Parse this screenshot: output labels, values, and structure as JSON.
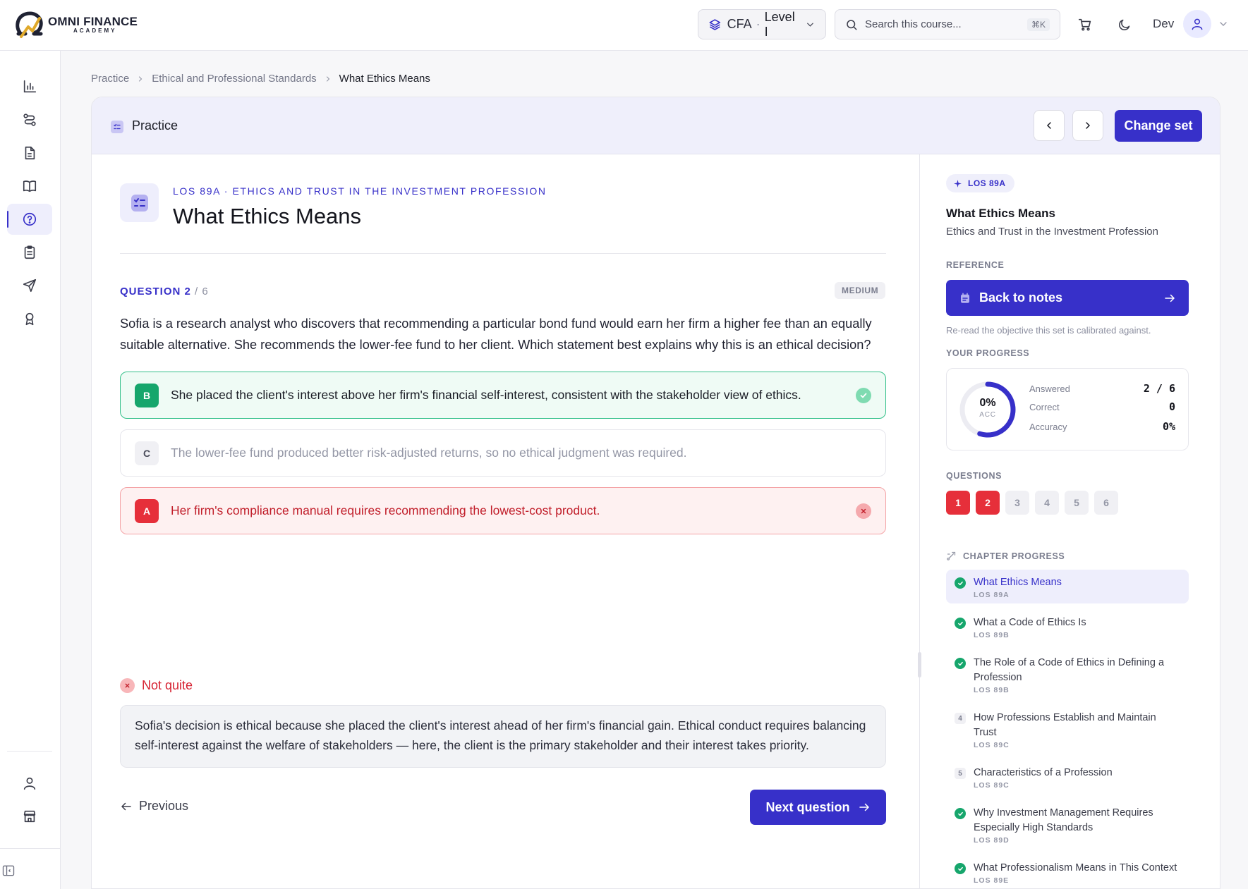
{
  "app": {
    "logo_title": "OMNI FINANCE",
    "logo_sub": "ACADEMY"
  },
  "header": {
    "course_prefix": "CFA",
    "course_sep": "·",
    "course_level": "Level I",
    "search_placeholder": "Search this course...",
    "search_shortcut": "⌘K",
    "user_name": "Dev"
  },
  "breadcrumb": [
    "Practice",
    "Ethical and Professional Standards",
    "What Ethics Means"
  ],
  "practice": {
    "header_title": "Practice",
    "change_set_label": "Change set",
    "los_line": "LOS 89A · ETHICS AND TRUST IN THE INVESTMENT PROFESSION",
    "title": "What Ethics Means",
    "question_label": "QUESTION 2",
    "question_total": "/ 6",
    "difficulty": "MEDIUM",
    "question_text": "Sofia is a research analyst who discovers that recommending a particular bond fund would earn her firm a higher fee than an equally suitable alternative. She recommends the lower-fee fund to her client. Which statement best explains why this is an ethical decision?",
    "options": [
      {
        "letter": "B",
        "text": "She placed the client's interest above her firm's financial self-interest, consistent with the stakeholder view of ethics.",
        "state": "correct"
      },
      {
        "letter": "C",
        "text": "The lower-fee fund produced better risk-adjusted returns, so no ethical judgment was required.",
        "state": "neutral"
      },
      {
        "letter": "A",
        "text": "Her firm's compliance manual requires recommending the lowest-cost product.",
        "state": "wrong"
      }
    ],
    "feedback_title": "Not quite",
    "explanation": "Sofia's decision is ethical because she placed the client's interest ahead of her firm's financial gain. Ethical conduct requires balancing self-interest against the welfare of stakeholders — here, the client is the primary stakeholder and their interest takes priority.",
    "previous_label": "Previous",
    "next_label": "Next question"
  },
  "side": {
    "los_pill": "LOS 89A",
    "title": "What Ethics Means",
    "subtitle": "Ethics and Trust in the Investment Profession",
    "reference_label": "REFERENCE",
    "back_notes_label": "Back to notes",
    "reference_note": "Re-read the objective this set is calibrated against.",
    "progress_label": "YOUR PROGRESS",
    "ring_value": "0%",
    "ring_label": "ACC",
    "accuracy_fraction": 0.55,
    "stats": [
      {
        "label": "Answered",
        "value": "2 / 6"
      },
      {
        "label": "Correct",
        "value": "0"
      },
      {
        "label": "Accuracy",
        "value": "0%"
      }
    ],
    "questions_label": "QUESTIONS",
    "question_chips": [
      {
        "num": "1",
        "state": "wrong"
      },
      {
        "num": "2",
        "state": "wrong"
      },
      {
        "num": "3",
        "state": "todo"
      },
      {
        "num": "4",
        "state": "todo"
      },
      {
        "num": "5",
        "state": "todo"
      },
      {
        "num": "6",
        "state": "todo"
      }
    ],
    "chapter_label": "CHAPTER PROGRESS",
    "chapters": [
      {
        "title": "What Ethics Means",
        "los": "LOS 89A",
        "status": "done",
        "active": true
      },
      {
        "title": "What a Code of Ethics Is",
        "los": "LOS 89B",
        "status": "done"
      },
      {
        "title": "The Role of a Code of Ethics in Defining a Profession",
        "los": "LOS 89B",
        "status": "done"
      },
      {
        "title": "How Professions Establish and Maintain Trust",
        "los": "LOS 89C",
        "status": "num",
        "num": "4"
      },
      {
        "title": "Characteristics of a Profession",
        "los": "LOS 89C",
        "status": "num",
        "num": "5"
      },
      {
        "title": "Why Investment Management Requires Especially High Standards",
        "los": "LOS 89D",
        "status": "done"
      },
      {
        "title": "What Professionalism Means in This Context",
        "los": "LOS 89E",
        "status": "done"
      }
    ]
  },
  "colors": {
    "accent": "#3730c9",
    "correct": "#16a66c",
    "wrong": "#e62f3a"
  },
  "icons": {
    "rail_top": [
      "bar-chart-icon",
      "route-icon",
      "document-icon",
      "book-icon",
      "help-circle-icon",
      "clipboard-icon",
      "send-icon",
      "award-icon"
    ],
    "rail_bottom": [
      "user-icon",
      "store-icon"
    ]
  }
}
